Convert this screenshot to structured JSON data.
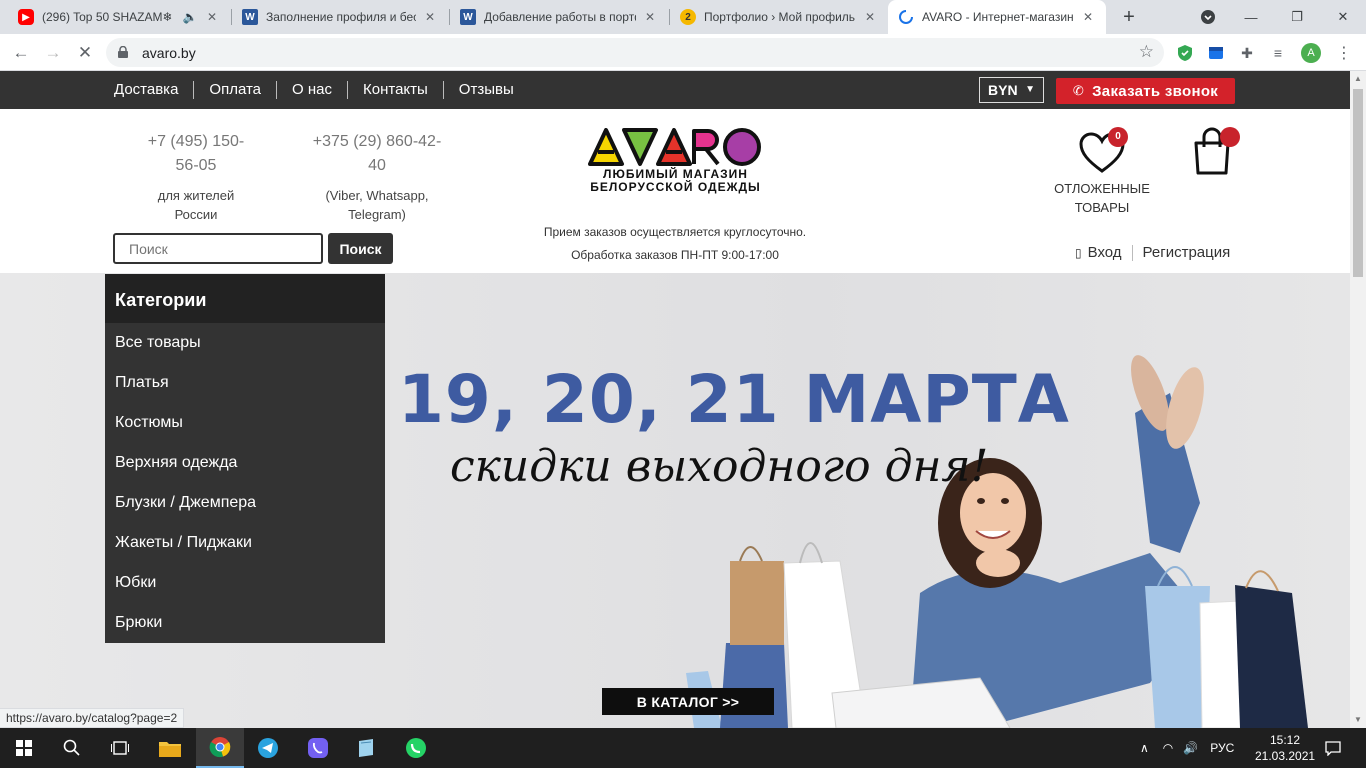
{
  "browser": {
    "tabs": [
      {
        "title": "(296) Top 50 SHAZAM❄",
        "icon": "youtube-icon"
      },
      {
        "title": "Заполнение профиля и бесп",
        "icon": "word-icon"
      },
      {
        "title": "Добавление работы в портф",
        "icon": "word-icon"
      },
      {
        "title": "Портфолио › Мой профиль",
        "icon": "kwork-icon"
      },
      {
        "title": "AVARO - Интернет-магазин",
        "icon": "loading-icon"
      }
    ],
    "url": "avaro.by",
    "profile_initial": "A"
  },
  "site": {
    "topnav": [
      "Доставка",
      "Оплата",
      "О нас",
      "Контакты",
      "Отзывы"
    ],
    "currency": "BYN",
    "call_button": "Заказать звонок",
    "phone_ru": {
      "number": "+7 (495) 150-56-05",
      "note": "для жителей России"
    },
    "phone_by": {
      "number": "+375 (29) 860-42-40",
      "note": "(Viber, Whatsapp, Telegram)"
    },
    "logo": {
      "brand": "AVARO",
      "tagline_1": "ЛЮБИМЫЙ МАГАЗИН",
      "tagline_2": "БЕЛОРУССКОЙ ОДЕЖДЫ"
    },
    "hours": {
      "line1": "Прием заказов осуществляется круглосуточно.",
      "line2": "Обработка заказов ПН-ПТ 9:00-17:00"
    },
    "search": {
      "placeholder": "Поиск",
      "button": "Поиск"
    },
    "wishlist": {
      "label_1": "ОТЛОЖЕННЫЕ",
      "label_2": "ТОВАРЫ",
      "count": "0"
    },
    "auth": {
      "login": "Вход",
      "register": "Регистрация"
    },
    "categories": {
      "title": "Категории",
      "items": [
        "Все товары",
        "Платья",
        "Костюмы",
        "Верхняя одежда",
        "Блузки / Джемпера",
        "Жакеты / Пиджаки",
        "Юбки",
        "Брюки"
      ]
    },
    "banner": {
      "date": "19, 20, 21 МАРТА",
      "subtitle": "скидки выходного дня!",
      "cta": "В КАТАЛОГ >>"
    }
  },
  "status_url": "https://avaro.by/catalog?page=2",
  "taskbar": {
    "lang": "РУС",
    "time": "15:12",
    "date": "21.03.2021"
  },
  "colors": {
    "site_dark": "#333333",
    "accent_red": "#d3222a",
    "promo_blue": "#3e5ba1"
  }
}
